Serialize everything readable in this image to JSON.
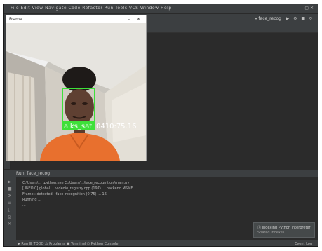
{
  "camera_window": {
    "title": "Frame",
    "controls": "–  ✕",
    "detection": {
      "label_left": "aiks_sat",
      "label_right": "0410:75.16"
    },
    "colors": {
      "box": "#3ee03a",
      "label_text": "#ffffff"
    }
  },
  "ide": {
    "title_menu": "File  Edit  View  Navigate  Code  Refactor  Run  Tools  VCS  Window  Help",
    "window_controls": "–  ▢  ✕",
    "run_config": "▾ face_recog",
    "toolbar_icons": "▶ ⚙ ■ ⟳",
    "run_tab_label": "Run: face_recog",
    "console_lines": [
      "C:\\Users\\... \\python.exe  C:/Users/.../face_recognition/main.py",
      "[ INFO:0] global ... videoio_registry.cpp (197) ... backend MSMF",
      "Frame : detected - face_recognition  (0.75)  ...  16",
      "Running ... ",
      "..."
    ],
    "side_icons": [
      "▶",
      "■",
      "⟳",
      "≡",
      "⤓",
      "⎙",
      "✕"
    ],
    "notification": {
      "title": "ⓘ  Indexing Python interpreter",
      "body": "Shared indexes"
    },
    "status_items": "▶ Run   ☰ TODO   ⚠ Problems   ▣ Terminal   ⎔ Python Console",
    "status_right": "Event Log"
  }
}
